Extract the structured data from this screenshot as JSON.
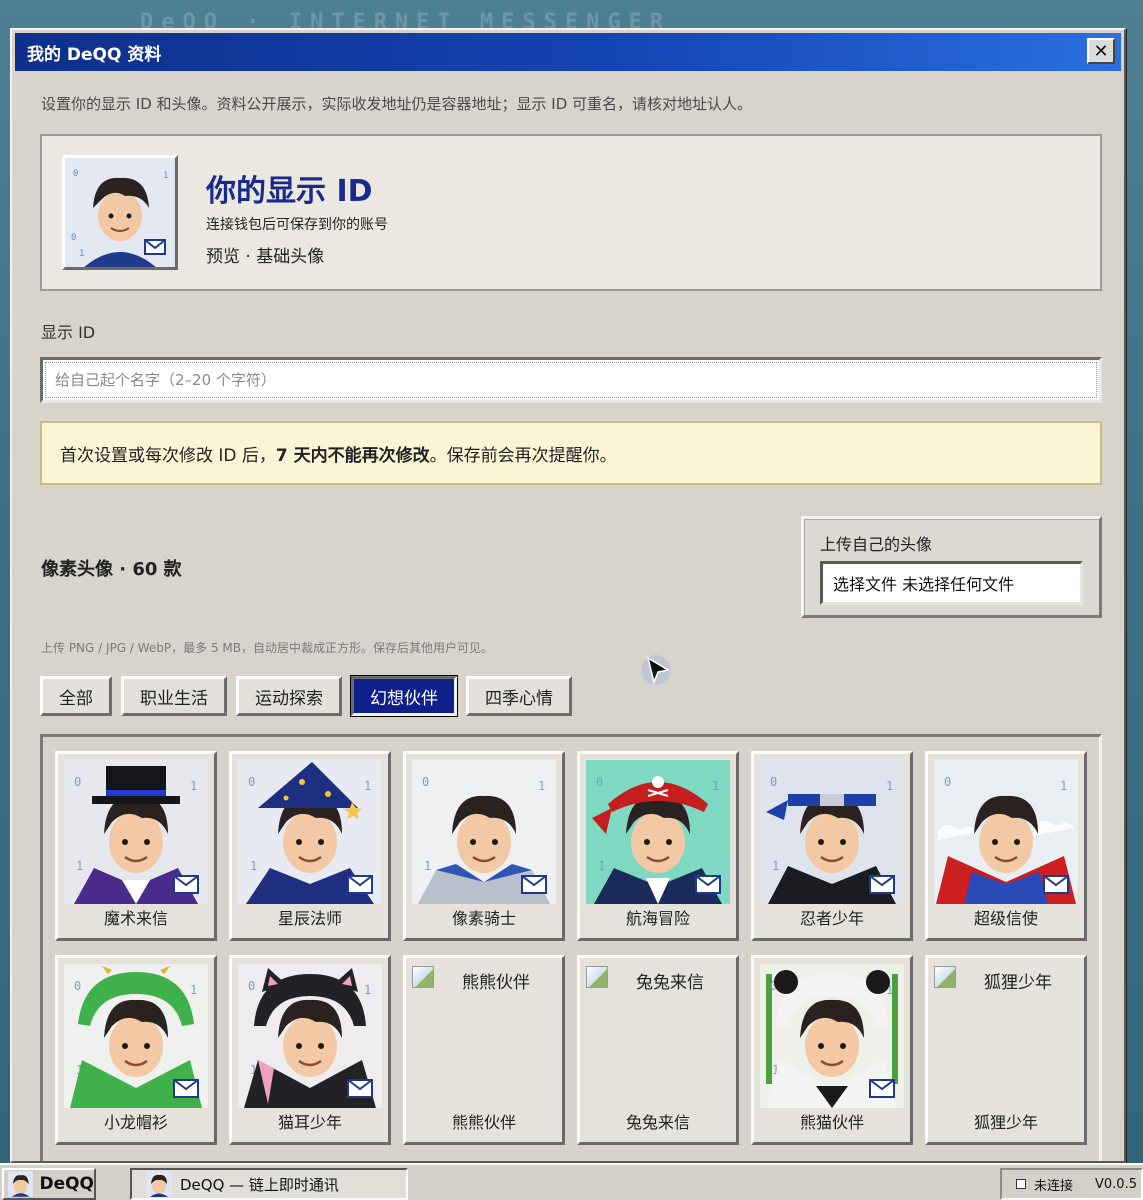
{
  "window": {
    "title": "我的 DeQQ 资料",
    "close": "✕"
  },
  "background_title": "DeQQ · INTERNET MESSENGER",
  "description": "设置你的显示 ID 和头像。资料公开展示，实际收发地址仍是容器地址；显示 ID 可重名，请核对地址认人。",
  "preview": {
    "title": "你的显示 ID",
    "subtitle": "连接钱包后可保存到你的账号",
    "meta": "预览 · 基础头像"
  },
  "id_field": {
    "label": "显示 ID",
    "placeholder": "给自己起个名字（2–20 个字符）",
    "value": ""
  },
  "notice": {
    "prefix": "首次设置或每次修改 ID 后，",
    "bold": "7 天内不能再次修改",
    "suffix": "。保存前会再次提醒你。"
  },
  "gallery_title": "像素头像 · 60 款",
  "upload": {
    "label": "上传自己的头像",
    "button": "选择文件",
    "status": "未选择任何文件",
    "hint": "上传 PNG / JPG / WebP，最多 5 MB，自动居中裁成正方形。保存后其他用户可见。"
  },
  "tabs": [
    {
      "label": "全部",
      "active": false
    },
    {
      "label": "职业生活",
      "active": false
    },
    {
      "label": "运动探索",
      "active": false
    },
    {
      "label": "幻想伙伴",
      "active": true
    },
    {
      "label": "四季心情",
      "active": false
    }
  ],
  "avatars": [
    {
      "caption": "魔术来信",
      "theme": "magician",
      "bg": "#e6e8ee",
      "accent": "#202030",
      "broken": false
    },
    {
      "caption": "星辰法师",
      "theme": "wizard",
      "bg": "#e7eaf0",
      "accent": "#1f2f7a",
      "broken": false
    },
    {
      "caption": "像素骑士",
      "theme": "knight",
      "bg": "#eef0f2",
      "accent": "#2f55b5",
      "broken": false
    },
    {
      "caption": "航海冒险",
      "theme": "pirate",
      "bg": "#7fd8c2",
      "accent": "#c41e1e",
      "broken": false
    },
    {
      "caption": "忍者少年",
      "theme": "ninja",
      "bg": "#dfe3ec",
      "accent": "#1d3fa8",
      "broken": false
    },
    {
      "caption": "超级信使",
      "theme": "hero",
      "bg": "#e9eef2",
      "accent": "#cc2020",
      "broken": false
    },
    {
      "caption": "小龙帽衫",
      "theme": "dragon",
      "bg": "#eef1ee",
      "accent": "#3fb04a",
      "broken": false
    },
    {
      "caption": "猫耳少年",
      "theme": "cat",
      "bg": "#eeecef",
      "accent": "#222226",
      "broken": false
    },
    {
      "caption": "熊熊伙伴",
      "theme": "bear",
      "bg": "#e5e2db",
      "accent": "#8a5a30",
      "broken": true,
      "alt": "熊熊伙伴"
    },
    {
      "caption": "兔兔来信",
      "theme": "bunny",
      "bg": "#e5e2db",
      "accent": "#cccccc",
      "broken": true,
      "alt": "兔兔来信"
    },
    {
      "caption": "熊猫伙伴",
      "theme": "panda",
      "bg": "#eef0ea",
      "accent": "#1a1a1a",
      "broken": false
    },
    {
      "caption": "狐狸少年",
      "theme": "fox",
      "bg": "#e5e2db",
      "accent": "#d06a20",
      "broken": true,
      "alt": "狐狸少年"
    }
  ],
  "taskbar": {
    "start": "DeQQ",
    "task": "DeQQ — 链上即时通讯",
    "status": "未连接",
    "version": "V0.0.5"
  }
}
